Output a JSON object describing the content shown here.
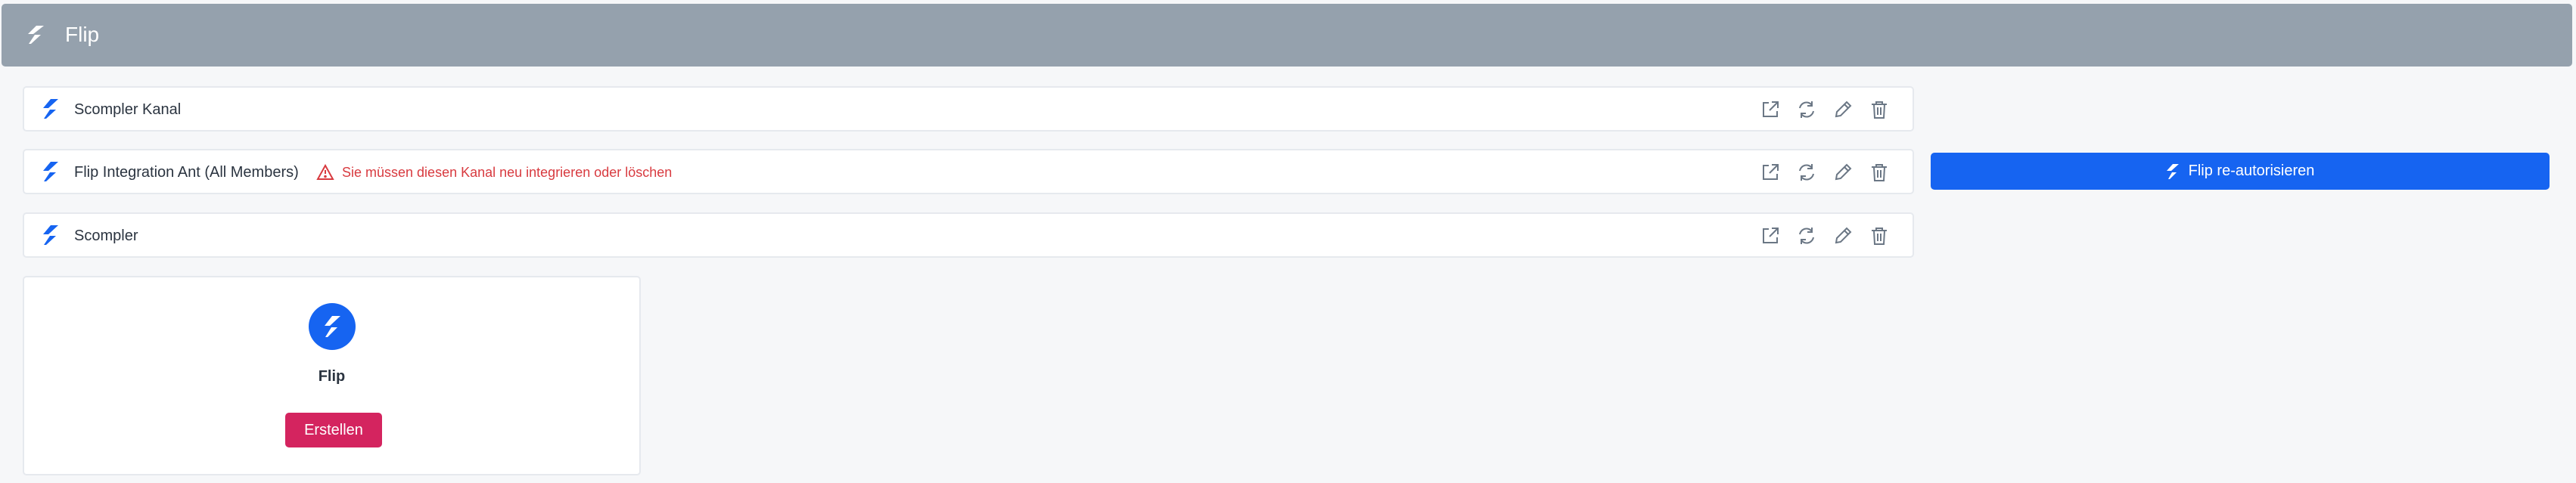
{
  "header": {
    "title": "Flip",
    "icon": "flip-logo-icon"
  },
  "channels": [
    {
      "name": "Scompler Kanal",
      "warning": ""
    },
    {
      "name": "Flip Integration Ant (All Members)",
      "warning": "Sie müssen diesen Kanal neu integrieren oder löschen"
    },
    {
      "name": "Scompler",
      "warning": ""
    }
  ],
  "reauth_button": {
    "label": "Flip re-autorisieren"
  },
  "card": {
    "title": "Flip",
    "button_label": "Erstellen"
  },
  "actions": [
    "external-link-icon",
    "refresh-icon",
    "pencil-icon",
    "trash-icon"
  ],
  "colors": {
    "header": "#95a1ad",
    "brand_blue": "#1664f1",
    "warning_red": "#d83a3f",
    "create_pink": "#d4245f"
  }
}
